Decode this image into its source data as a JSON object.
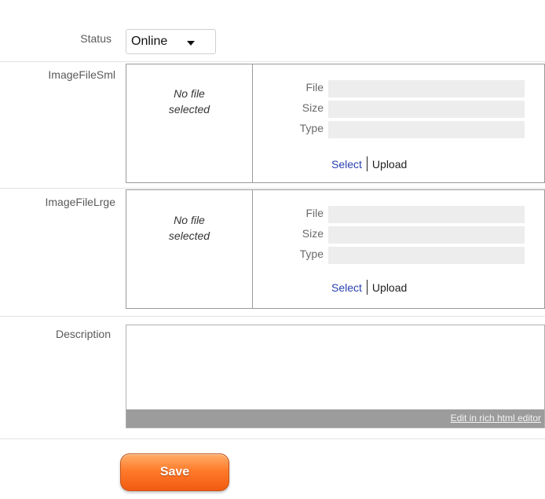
{
  "status": {
    "label": "Status",
    "value": "Online"
  },
  "image_small": {
    "label": "ImageFileSml",
    "preview_text": "No file selected",
    "file_label": "File",
    "size_label": "Size",
    "type_label": "Type",
    "select_label": "Select",
    "upload_label": "Upload"
  },
  "image_large": {
    "label": "ImageFileLrge",
    "preview_text": "No file selected",
    "file_label": "File",
    "size_label": "Size",
    "type_label": "Type",
    "select_label": "Select",
    "upload_label": "Upload"
  },
  "description": {
    "label": "Description",
    "value": "",
    "editor_link": "Edit in rich html editor"
  },
  "save": {
    "label": "Save"
  },
  "colors": {
    "link": "#2a40b0",
    "save_button": "#f2661a",
    "editor_bar": "#9c9c9c"
  }
}
